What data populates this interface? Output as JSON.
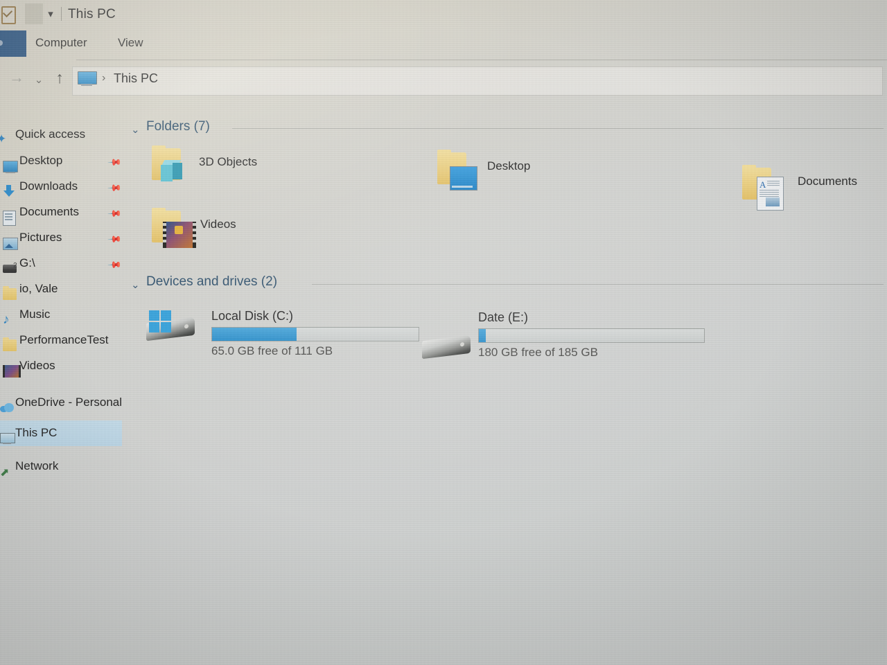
{
  "window": {
    "title": "This PC",
    "qat_icon": "checklist-icon",
    "qat_caret": "▾"
  },
  "ribbon": {
    "tabs": [
      {
        "label": "Computer",
        "icon": "computer-tab"
      },
      {
        "label": "View",
        "icon": "view-tab"
      }
    ]
  },
  "address_bar": {
    "forward_icon": "→",
    "recent_icon": "⌄",
    "up_icon": "↑",
    "location_icon": "this-pc-icon",
    "separator": "›",
    "path": "This PC"
  },
  "sidebar": {
    "items": [
      {
        "label": "Quick access",
        "icon": "quick-access-pin-icon",
        "pinned": false,
        "indent": false,
        "selected": false
      },
      {
        "label": "Desktop",
        "icon": "desktop-icon",
        "pinned": true,
        "indent": true,
        "selected": false
      },
      {
        "label": "Downloads",
        "icon": "downloads-icon",
        "pinned": true,
        "indent": true,
        "selected": false
      },
      {
        "label": "Documents",
        "icon": "documents-icon",
        "pinned": true,
        "indent": true,
        "selected": false
      },
      {
        "label": "Pictures",
        "icon": "pictures-icon",
        "pinned": true,
        "indent": true,
        "selected": false
      },
      {
        "label": "G:\\",
        "icon": "drive-icon",
        "pinned": true,
        "indent": true,
        "selected": false
      },
      {
        "label": "io, Vale",
        "icon": "folder-icon",
        "pinned": false,
        "indent": true,
        "selected": false
      },
      {
        "label": "Music",
        "icon": "music-icon",
        "pinned": false,
        "indent": true,
        "selected": false
      },
      {
        "label": "PerformanceTest",
        "icon": "folder-icon",
        "pinned": false,
        "indent": true,
        "selected": false
      },
      {
        "label": "Videos",
        "icon": "videos-icon",
        "pinned": false,
        "indent": true,
        "selected": false
      },
      {
        "label": "OneDrive - Personal",
        "icon": "onedrive-icon",
        "pinned": false,
        "indent": false,
        "selected": false
      },
      {
        "label": "This PC",
        "icon": "this-pc-icon",
        "pinned": false,
        "indent": false,
        "selected": true
      },
      {
        "label": "Network",
        "icon": "network-icon",
        "pinned": false,
        "indent": false,
        "selected": false
      }
    ]
  },
  "content": {
    "folders_section": {
      "title": "Folders (7)",
      "chevron": "⌄",
      "items": [
        {
          "label": "3D Objects",
          "icon": "3d-objects-folder-icon"
        },
        {
          "label": "Desktop",
          "icon": "desktop-folder-icon"
        },
        {
          "label": "Documents",
          "icon": "documents-folder-icon"
        },
        {
          "label": "Videos",
          "icon": "videos-folder-icon"
        }
      ]
    },
    "drives_section": {
      "title": "Devices and drives (2)",
      "chevron": "⌄",
      "drives": [
        {
          "name": "Local Disk (C:)",
          "free_text": "65.0 GB free of 111 GB",
          "used_percent": 41,
          "icon": "local-disk-icon",
          "has_windows_logo": true
        },
        {
          "name": "Date (E:)",
          "free_text": "180 GB free of 185 GB",
          "used_percent": 3,
          "icon": "hard-drive-icon",
          "has_windows_logo": false
        }
      ]
    }
  },
  "colors": {
    "accent_blue": "#2b90cd",
    "selection_blue": "#bcd7e8",
    "section_header": "#31536f",
    "file_tab_blue": "#2a5584",
    "folder_yellow": "#edd07f"
  }
}
